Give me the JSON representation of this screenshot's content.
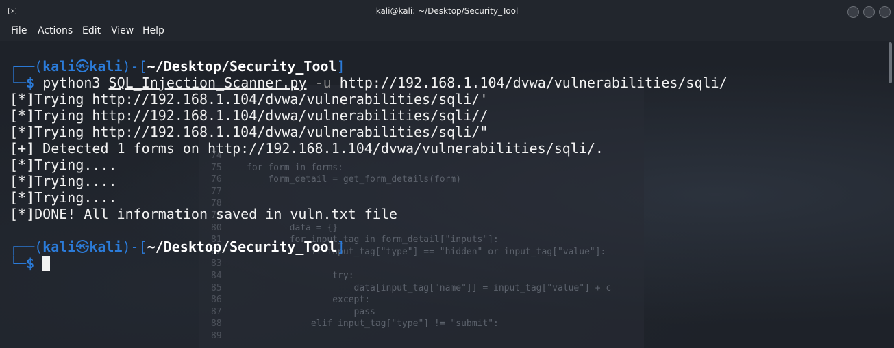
{
  "window": {
    "title": "kali@kali: ~/Desktop/Security_Tool"
  },
  "menu": [
    "File",
    "Actions",
    "Edit",
    "View",
    "Help"
  ],
  "prompt": {
    "corner_top": "┌──(",
    "user": "kali",
    "at_symbol": "㉿",
    "host": "kali",
    "sep": ")-[",
    "path": "~/Desktop/Security_Tool",
    "close": "]",
    "corner_bottom": "└─",
    "dollar": "$"
  },
  "command": {
    "program": "python3",
    "script": "SQL_Injection_Scanner.py",
    "flag": "-u",
    "url": "http://192.168.1.104/dvwa/vulnerabilities/sqli/"
  },
  "output": [
    "[*]Trying http://192.168.1.104/dvwa/vulnerabilities/sqli/'",
    "[*]Trying http://192.168.1.104/dvwa/vulnerabilities/sqli//",
    "[*]Trying http://192.168.1.104/dvwa/vulnerabilities/sqli/\"",
    "[+] Detected 1 forms on http://192.168.1.104/dvwa/vulnerabilities/sqli/.",
    "[*]Trying....",
    "[*]Trying....",
    "[*]Trying....",
    "[*]DONE! All information saved in vuln.txt file"
  ],
  "background_code": [
    {
      "ln": "74",
      "code": ""
    },
    {
      "ln": "75",
      "code": "for form in forms:"
    },
    {
      "ln": "76",
      "code": "    form_detail = get_form_details(form)"
    },
    {
      "ln": "77",
      "code": ""
    },
    {
      "ln": "78",
      "code": ""
    },
    {
      "ln": "79",
      "code": ""
    },
    {
      "ln": "80",
      "code": "        data = {}"
    },
    {
      "ln": "81",
      "code": "        for input_tag in form_detail[\"inputs\"]:"
    },
    {
      "ln": "82",
      "code": "            if input_tag[\"type\"] == \"hidden\" or input_tag[\"value\"]:"
    },
    {
      "ln": "83",
      "code": ""
    },
    {
      "ln": "84",
      "code": "                try:"
    },
    {
      "ln": "85",
      "code": "                    data[input_tag[\"name\"]] = input_tag[\"value\"] + c"
    },
    {
      "ln": "86",
      "code": "                except:"
    },
    {
      "ln": "87",
      "code": "                    pass"
    },
    {
      "ln": "88",
      "code": "            elif input_tag[\"type\"] != \"submit\":"
    },
    {
      "ln": "89",
      "code": ""
    }
  ]
}
